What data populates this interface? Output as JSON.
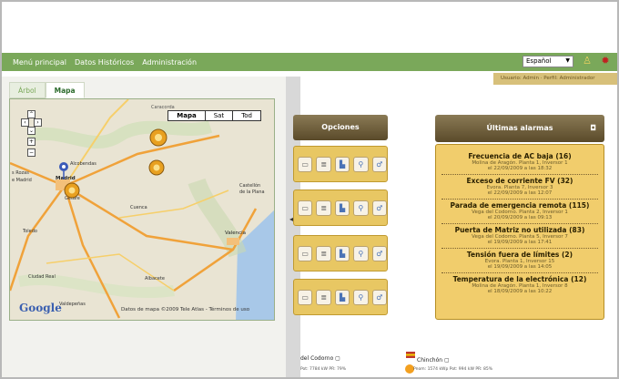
{
  "nav": {
    "items": [
      "Menú principal",
      "Datos Históricos",
      "Administración"
    ],
    "language": "Español",
    "user_info": "Usuario: Admin · Perfil: Administrador"
  },
  "left_panel": {
    "tabs": [
      "Árbol",
      "Mapa"
    ],
    "active_tab": "Mapa",
    "map_types": [
      "Mapa",
      "Sat",
      "Tod"
    ],
    "selected_map_type": "Mapa",
    "map_labels": [
      "Caracorda",
      "Alcobendas",
      "Las Rozas de Madrid",
      "Madrid",
      "Getafe",
      "Toledo",
      "Cuenca",
      "Castellón de la Plana",
      "Valencia",
      "Albacete",
      "Ciudad Real",
      "Valdepeñas"
    ],
    "google_logo": "Google",
    "map_credit": "Datos de mapa ©2009 Tele Atlas - Términos de uso"
  },
  "options": {
    "header": "Opciones",
    "row_count": 4,
    "icons": [
      "document-icon",
      "list-icon",
      "chart-icon",
      "search-icon",
      "settings-icon"
    ]
  },
  "alarms": {
    "header": "Últimas alarmas",
    "items": [
      {
        "title": "Frecuencia de AC baja (16)",
        "place": "Molina de Aragón. Planta 1, Inversor 1",
        "date": "el 22/09/2009 a las 18:32"
      },
      {
        "title": "Exceso de corriente FV (32)",
        "place": "Evora. Planta 7, Inversor 3",
        "date": "el 22/09/2009 a las 12:07"
      },
      {
        "title": "Parada de emergencia remota (115)",
        "place": "Vega del Codorno. Planta 2, Inversor 1",
        "date": "el 20/09/2009 a las 09:13"
      },
      {
        "title": "Puerta de Matriz no utilizada (83)",
        "place": "Vega del Codorno. Planta 5, Inversor 7",
        "date": "el 19/09/2009 a las 17:41"
      },
      {
        "title": "Tensión fuera de límites (2)",
        "place": "Evora. Planta 1, Inversor 15",
        "date": "el 19/09/2009 a las 14:05"
      },
      {
        "title": "Temperatura de la electrónica (12)",
        "place": "Molina de Aragón. Planta 1, Inversor 8",
        "date": "el 18/09/2009 a las 10:22"
      }
    ]
  },
  "plants": [
    {
      "name": "del Codorno",
      "stats": "Pot: 7784 kW  PR: 79%"
    },
    {
      "name": "Chinchón",
      "stats": "Pnom: 1574 kWp  Pot: 994 kW  PR: 85%"
    }
  ],
  "colors": {
    "nav_green": "#7aa85a",
    "option_gold": "#e8c763",
    "alarm_gold": "#f1cd6c",
    "header_brown": "#6a5a35"
  }
}
